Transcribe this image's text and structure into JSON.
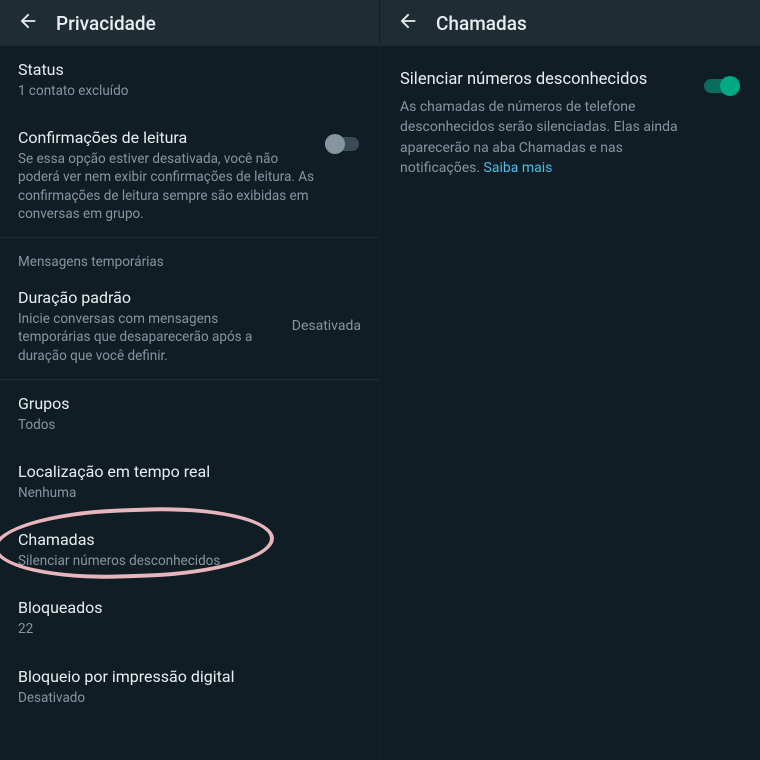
{
  "left": {
    "appbar_title": "Privacidade",
    "status": {
      "title": "Status",
      "sub": "1 contato excluído"
    },
    "read_receipts": {
      "title": "Confirmações de leitura",
      "sub": "Se essa opção estiver desativada, você não poderá ver nem exibir confirmações de leitura. As confirmações de leitura sempre são exibidas em conversas em grupo."
    },
    "disappearing_section": "Mensagens temporárias",
    "default_duration": {
      "title": "Duração padrão",
      "sub": "Inicie conversas com mensagens temporárias que desaparecerão após a duração que você definir.",
      "value": "Desativada"
    },
    "groups": {
      "title": "Grupos",
      "sub": "Todos"
    },
    "live_location": {
      "title": "Localização em tempo real",
      "sub": "Nenhuma"
    },
    "calls": {
      "title": "Chamadas",
      "sub": "Silenciar números desconhecidos"
    },
    "blocked": {
      "title": "Bloqueados",
      "sub": "22"
    },
    "fingerprint": {
      "title": "Bloqueio por impressão digital",
      "sub": "Desativado"
    }
  },
  "right": {
    "appbar_title": "Chamadas",
    "silence": {
      "title": "Silenciar números desconhecidos",
      "desc": "As chamadas de números de telefone desconhecidos serão silenciadas. Elas ainda aparecerão na aba Chamadas e nas notificações. ",
      "link": "Saiba mais"
    }
  }
}
